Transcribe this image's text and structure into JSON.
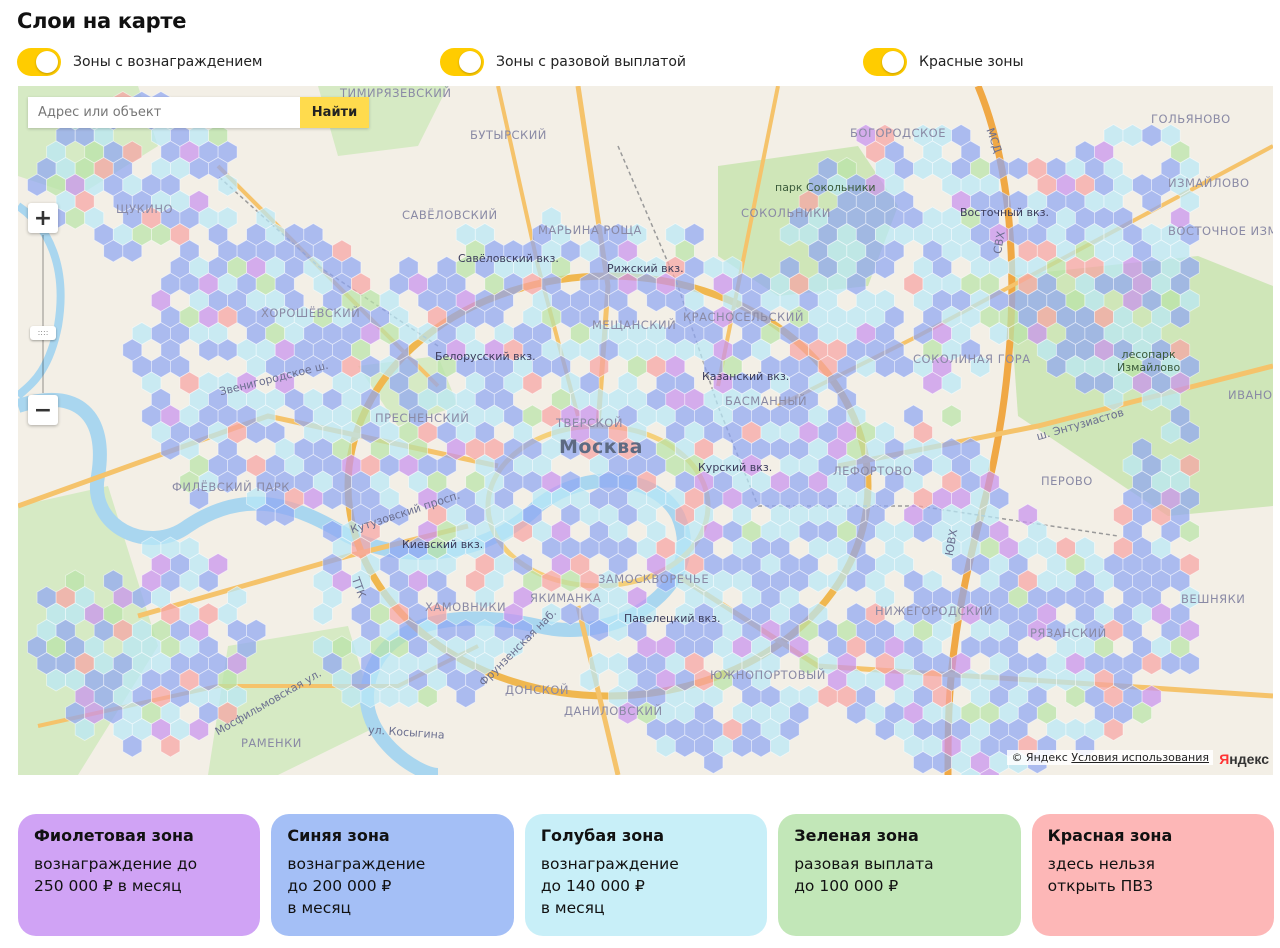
{
  "page_title": "Слои на карте",
  "toggles": [
    {
      "label": "Зоны с вознаграждением",
      "on": true
    },
    {
      "label": "Зоны с разовой выплатой",
      "on": true
    },
    {
      "label": "Красные зоны",
      "on": true
    }
  ],
  "search": {
    "placeholder": "Адрес или объект",
    "button": "Найти"
  },
  "zoom": {
    "in": "+",
    "out": "−",
    "handle": "::::"
  },
  "map": {
    "city": "Москва",
    "districts": [
      "ТИМИРЯЗЕВСКИЙ",
      "БУТЫРСКИЙ",
      "ГОЛЬЯНОВО",
      "ЩУКИНО",
      "СОКОЛЬНИКИ",
      "БОГОРОДСКОЕ",
      "МАРЬИНА РОЩА",
      "САВЁЛОВСКИЙ",
      "ХОРОШЁВСКИЙ",
      "МЕЩАНСКИЙ",
      "КРАСНОСЕЛЬСКИЙ",
      "СОКОЛИНАЯ ГОРА",
      "ПРЕСНЕНСКИЙ",
      "БАСМАННЫЙ",
      "ТВЕРСКОЙ",
      "ЛЕФОРТОВО",
      "ПЕРОВО",
      "ФИЛЁВСКИЙ ПАРК",
      "ХАМОВНИКИ",
      "ЯКИМАНКА",
      "ЗАМОСКВОРЕЧЬЕ",
      "НИЖЕГОРОДСКИЙ",
      "ВЕШНЯКИ",
      "ДОНСКОЙ",
      "ДАНИЛОВСКИЙ",
      "РАМЕНКИ",
      "ЮЖНОПОРТОВЫЙ",
      "РЯЗАНСКИЙ",
      "ИЗМАЙЛОВО",
      "ВОСТОЧНОЕ ИЗМАЙЛОВО",
      "ИВАНОВСКОЕ",
      "ВЕШНЯКИ"
    ],
    "stations": [
      "Савёловский вкз.",
      "Рижский вкз.",
      "Белорусский вкз.",
      "Казанский вкз.",
      "Курский вкз.",
      "Киевский вкз.",
      "Павелецкий вкз.",
      "Восточный вкз."
    ],
    "parks": [
      "парк Сокольники",
      "лесопарк\nИзмайлово"
    ],
    "roads": [
      "Звенигородское ш.",
      "Кутузовский просп.",
      "ш. Энтузиастов",
      "ул. Косыгина",
      "Мосфильмовская ул.",
      "Фрунзенская наб.",
      "МСД",
      "СВХ",
      "ЮВХ",
      "ТТК"
    ]
  },
  "copyright": {
    "prefix": "© Яндекс",
    "terms": "Условия использования",
    "logo_ya": "Я",
    "logo_rest": "ндекс"
  },
  "legend": [
    {
      "title": "Фиолетовая зона",
      "text": "вознаграждение до\n250 000 ₽ в месяц",
      "color": "#d0a3f5"
    },
    {
      "title": "Синяя зона",
      "text": "вознаграждение\nдо 200 000 ₽\nв месяц",
      "color": "#a4bff6"
    },
    {
      "title": "Голубая зона",
      "text": "вознаграждение\nдо 140 000 ₽\nв месяц",
      "color": "#c8eff8"
    },
    {
      "title": "Зеленая зона",
      "text": "разовая выплата\nдо 100 000 ₽",
      "color": "#c2e7b8"
    },
    {
      "title": "Красная зона",
      "text": "здесь нельзя\nоткрыть ПВЗ",
      "color": "#fdb7b7"
    }
  ]
}
